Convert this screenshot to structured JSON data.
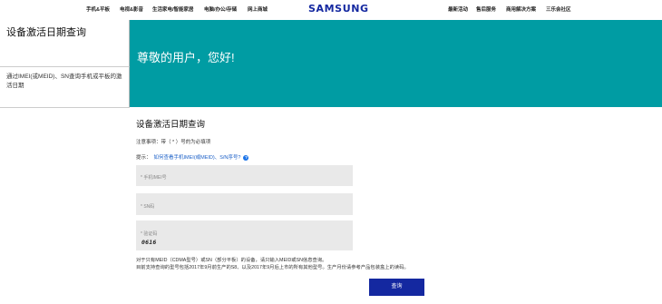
{
  "brand": {
    "logo": "SAMSUNG"
  },
  "nav": {
    "left_items": [
      "手机&平板",
      "电视&影音",
      "生活家电/智能家居",
      "电脑/办公/存储",
      "网上商城"
    ],
    "right_items": [
      "最新活动",
      "售后服务",
      "商用解决方案",
      "三乐会社区"
    ]
  },
  "sidebar": {
    "title": "设备激活日期查询",
    "link": "通过IMEI(或MEID)、SN查询手机或平板的激活日期"
  },
  "banner": {
    "greeting": "尊敬的用户，您好!"
  },
  "form": {
    "title": "设备激活日期查询",
    "notice": "注意事项：带（ * ）号的为必填项",
    "tip_label": "提示：",
    "tip_link": "如何查看手机IMEI(或MEID)、S/N序号?",
    "imei_placeholder": "* 手机IMEI号",
    "sn_placeholder": "* SN码",
    "captcha_placeholder": "* 验证码",
    "captcha_code": "0616",
    "footnote_line1": "对于只有MEID（CDMA型号）或SN（部分平板）的设备，请只输入MEID或SN信息查询。",
    "footnote_line2": "目前支持查询的型号包括2017年9月前生产的S8、以及2017年9月后上市的所有其他型号。生产月份请参考产品包装盒上的读码。",
    "submit_label": "查询"
  },
  "colors": {
    "banner": "#009ca3",
    "button": "#1428a0",
    "link": "#1a5fc7"
  }
}
